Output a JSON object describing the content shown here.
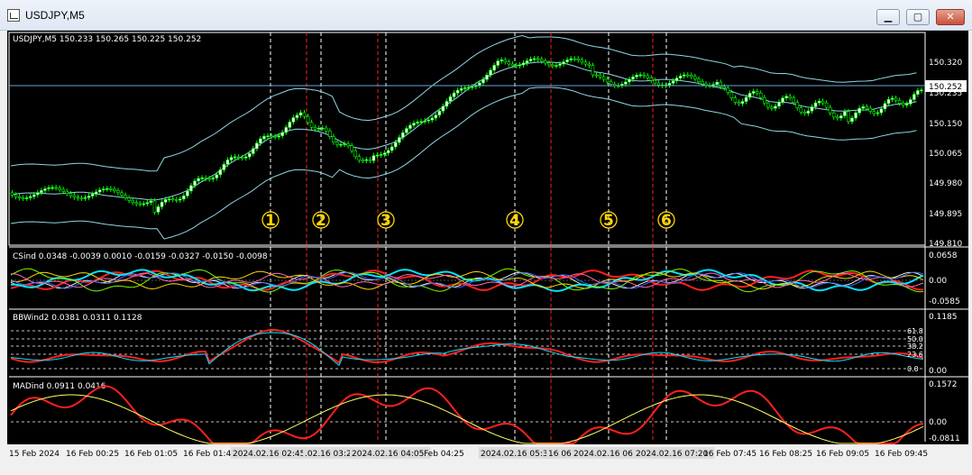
{
  "window": {
    "title": "USDJPY,M5",
    "minimize_icon": "minimize-icon",
    "maximize_icon": "maximize-icon",
    "close_icon": "close-icon"
  },
  "main_pane": {
    "header": "USDJPY,M5  150.233 150.265 150.225 150.252",
    "price_scale": [
      "150.320",
      "150.235",
      "150.150",
      "150.065",
      "149.980",
      "149.895",
      "149.810"
    ],
    "current_price": "150.252",
    "markers": [
      "1",
      "2",
      "3",
      "4",
      "5",
      "6"
    ],
    "colors": {
      "bull_candle": "#ffffff",
      "bear_candle": "#000000",
      "candle_outline": "#00ff00",
      "bands": "#8fd6e6",
      "price_line": "#6aa6d8"
    }
  },
  "csind_pane": {
    "header": "CSind 0.0348 -0.0039 0.0010 -0.0159 -0.0327 -0.0150 -0.0098",
    "scale": [
      "0.0658",
      "0.00",
      "-0.0585"
    ]
  },
  "bbwind_pane": {
    "header": "BBWind2 0.0381 0.0311 0.1128",
    "scale": [
      "0.1185",
      "0.00"
    ],
    "fib_levels": [
      "61.8",
      "50.0",
      "38.2",
      "23.6",
      "0.0"
    ]
  },
  "madind_pane": {
    "header": "MADind 0.0911 0.0416",
    "scale": [
      "0.1572",
      "0.00",
      "-0.0811"
    ]
  },
  "time_axis": [
    "15 Feb 2024",
    "16 Feb 00:25",
    "16 Feb 01:05",
    "16 Feb 01:45",
    "2024.02.16 02:45",
    ".02.16 03:2",
    "2024.02.16 04:05",
    "Feb 04:25",
    "2024.02.16 05:35",
    "16 06",
    "2024.02.16  06",
    "2024.02.16 07:20",
    "16 Feb 07:45",
    "16 Feb 08:25",
    "16 Feb 09:05",
    "16 Feb 09:45"
  ]
}
